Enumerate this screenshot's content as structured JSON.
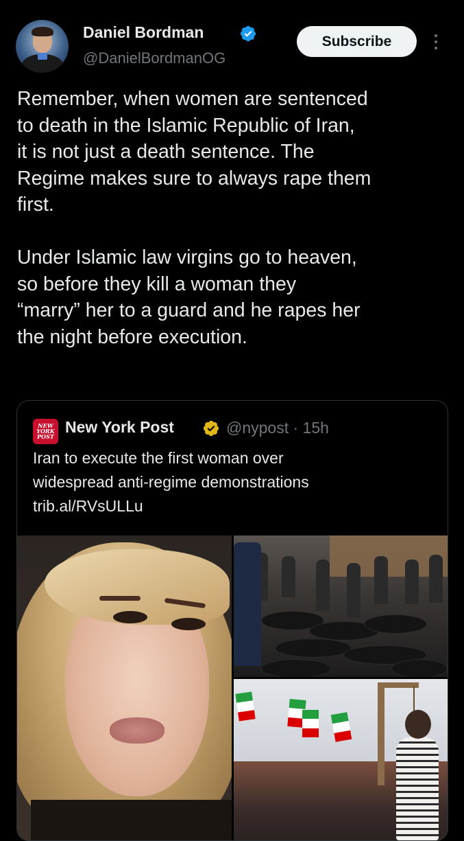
{
  "author": {
    "name": "Daniel Bordman",
    "handle": "@DanielBordmanOG",
    "verified_icon": "verified-badge-icon"
  },
  "actions": {
    "subscribe_label": "Subscribe",
    "more_icon": "more-vertical-icon"
  },
  "tweet": {
    "lines": [
      "Remember, when women are sentenced",
      "to death in the Islamic Republic of Iran,",
      "it is not just a death sentence. The",
      "Regime makes sure to always rape them",
      "first.",
      "",
      "Under Islamic law virgins go to heaven,",
      "so before they kill a woman they",
      "“marry” her to a guard and he rapes her",
      "the night before execution."
    ]
  },
  "quote": {
    "logo_text": [
      "NEW",
      "YORK",
      "POST"
    ],
    "name": "New York Post",
    "handle_time": "@nypost · 15h",
    "lines": [
      "Iran to execute the first woman over",
      "widespread anti-regime demonstrations",
      "trib.al/RVsULLu"
    ]
  },
  "colors": {
    "background": "#000000",
    "text": "#e7e9ea",
    "secondary": "#71767b",
    "verified_blue": "#1d9bf0",
    "gold": "#e2b719",
    "nyp_red": "#c8102e"
  }
}
